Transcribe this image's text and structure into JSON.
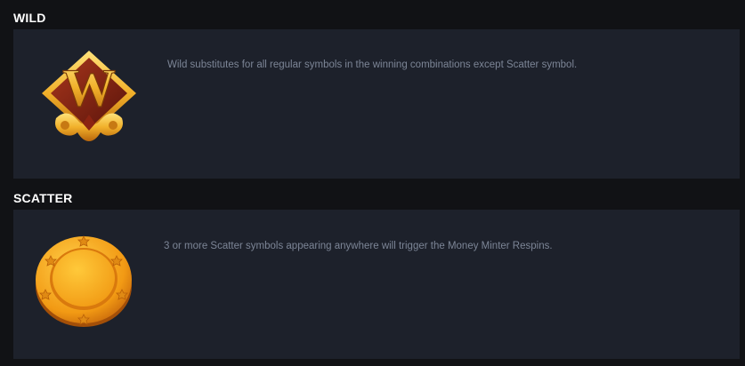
{
  "sections": [
    {
      "title": "WILD",
      "symbol_icon": "wild-w-emblem-icon",
      "letter": "W",
      "description": "Wild substitutes for all regular symbols in the winning combinations except Scatter symbol."
    },
    {
      "title": "SCATTER",
      "symbol_icon": "gold-coin-icon",
      "description": "3 or more Scatter symbols appearing anywhere will trigger the Money Minter Respins."
    }
  ],
  "colors": {
    "background": "#111215",
    "panel": "#1d212b",
    "title_text": "#ffffff",
    "description_text": "#7c8596",
    "gold": "#f2a623",
    "wild_diamond": "#7a1f12"
  }
}
